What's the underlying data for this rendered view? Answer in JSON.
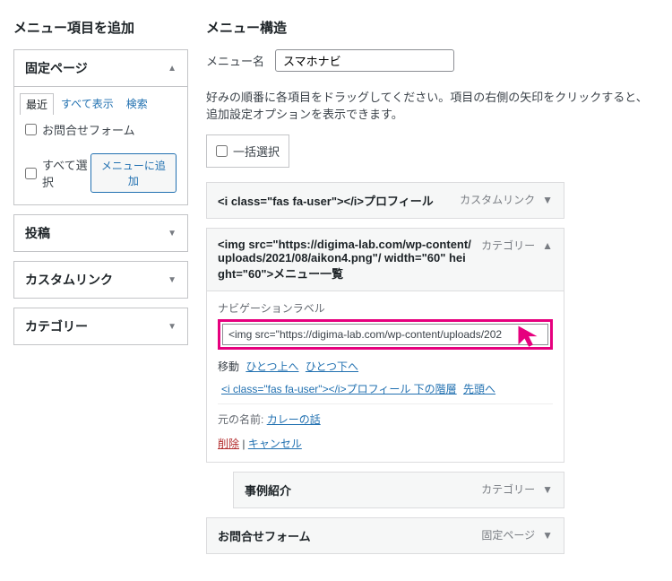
{
  "left": {
    "heading": "メニュー項目を追加",
    "fixed_page": {
      "title": "固定ページ",
      "tabs": {
        "recent": "最近",
        "all": "すべて表示",
        "search": "検索"
      },
      "items": [
        {
          "label": "お問合せフォーム"
        }
      ],
      "select_all": "すべて選択",
      "add_button": "メニューに追加"
    },
    "posts": {
      "title": "投稿"
    },
    "custom_link": {
      "title": "カスタムリンク"
    },
    "category": {
      "title": "カテゴリー"
    }
  },
  "right": {
    "heading": "メニュー構造",
    "menu_name_label": "メニュー名",
    "menu_name_value": "スマホナビ",
    "hint": "好みの順番に各項目をドラッグしてください。項目の右側の矢印をクリックすると、追加設定オプションを表示できます。",
    "bulk_select": "一括選択",
    "items": [
      {
        "title": "<i class=\"fas fa-user\"></i>プロフィール",
        "type": "カスタムリンク",
        "expanded": false
      },
      {
        "title": "<img src=\"https://digima-lab.com/wp-content/uploads/2021/08/aikon4.png\"/ width=\"60\" height=\"60\">メニュー一覧",
        "type": "カテゴリー",
        "expanded": true,
        "nav_label_caption": "ナビゲーションラベル",
        "nav_label_value": "<img src=\"https://digima-lab.com/wp-content/uploads/202",
        "move": {
          "label": "移動",
          "up": "ひとつ上へ",
          "down": "ひとつ下へ",
          "sub": "<i class=\"fas fa-user\"></i>プロフィール 下の階層",
          "top": "先頭へ"
        },
        "original_label": "元の名前:",
        "original_value": "カレーの話",
        "delete": "削除",
        "cancel": "キャンセル"
      },
      {
        "title": "事例紹介",
        "type": "カテゴリー",
        "expanded": false,
        "indent": true
      },
      {
        "title": "お問合せフォーム",
        "type": "固定ページ",
        "expanded": false
      }
    ]
  }
}
